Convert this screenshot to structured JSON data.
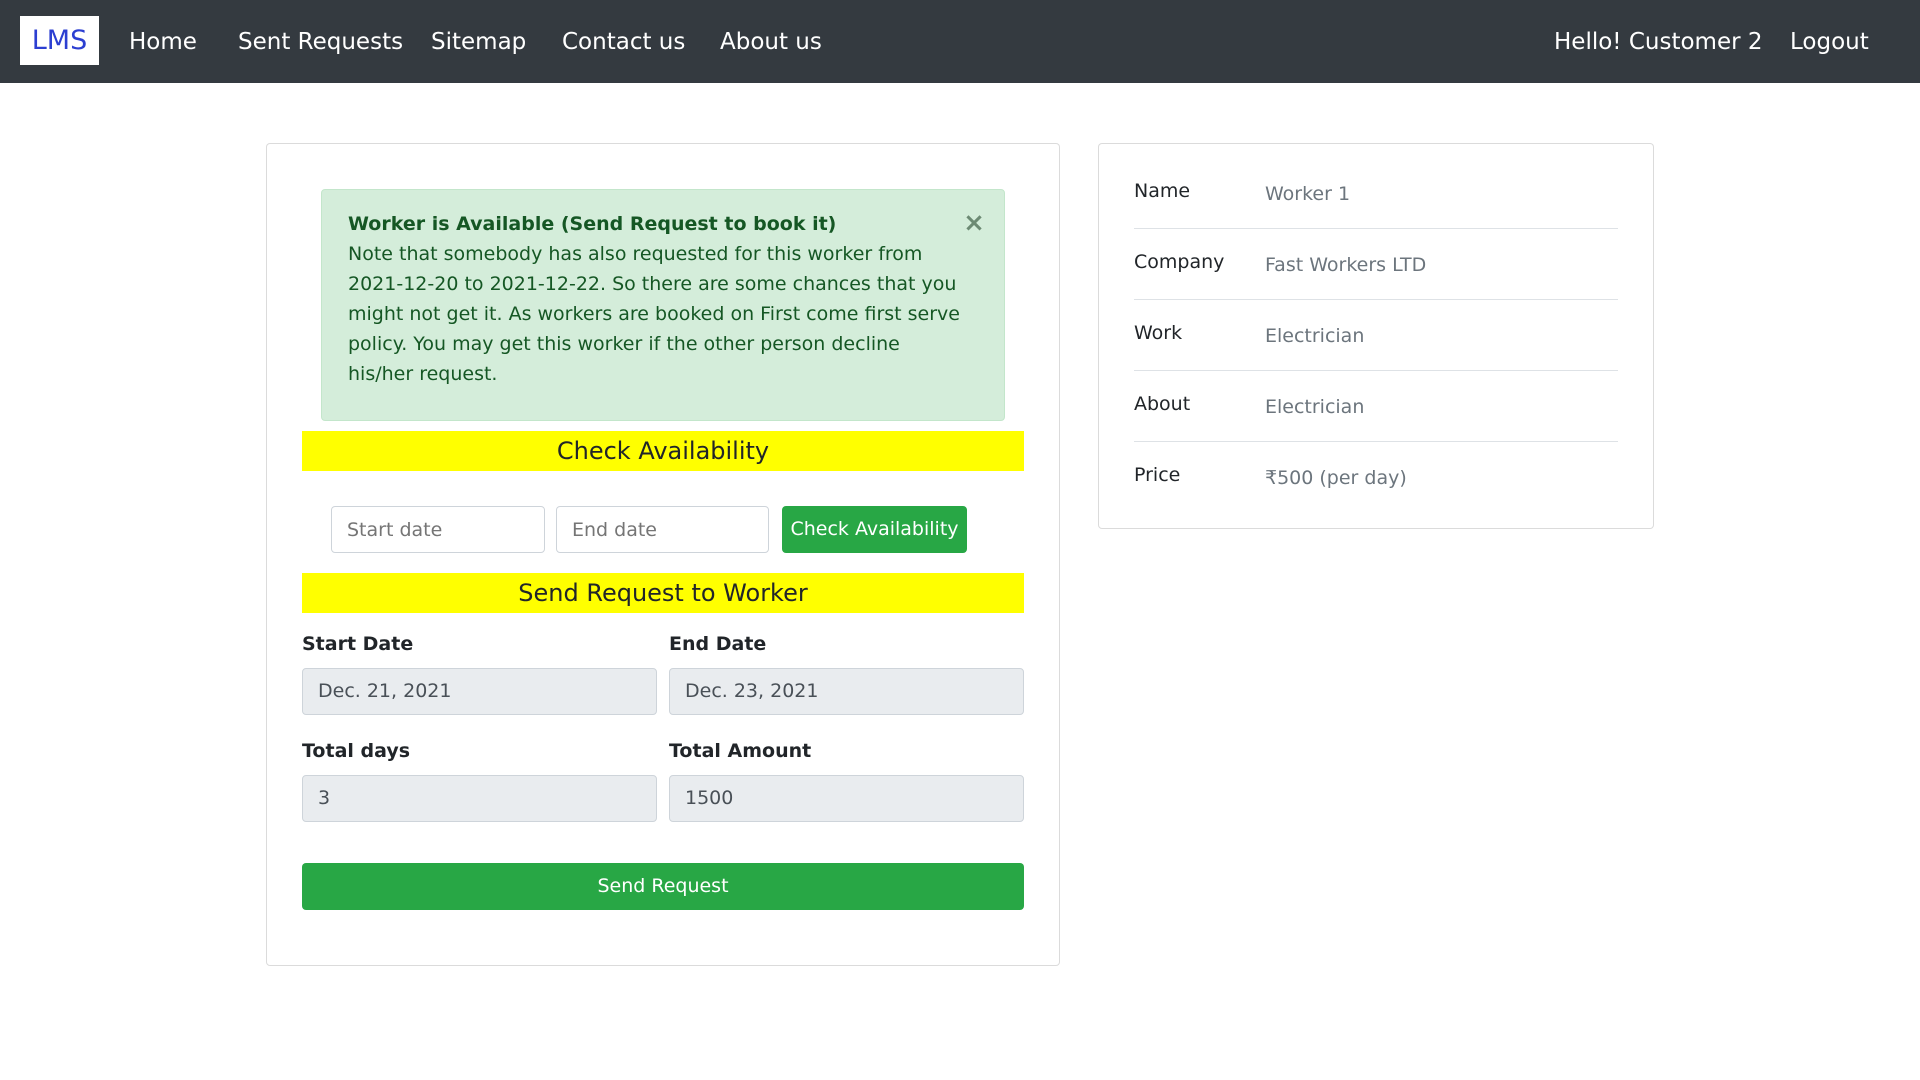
{
  "navbar": {
    "brand": "LMS",
    "links": [
      "Home",
      "Sent Requests",
      "Sitemap",
      "Contact us",
      "About us"
    ],
    "greeting": "Hello! Customer 2",
    "logout": "Logout"
  },
  "alert": {
    "title": "Worker is Available (Send Request to book it)",
    "lines": [
      "Note that somebody has also requested for this worker from",
      "2021-12-20 to 2021-12-22. So there are some chances that you",
      "might not get it. As workers are booked on First come first serve",
      "policy. You may get this worker if the other person decline",
      "his/her request."
    ],
    "close": "×"
  },
  "check_availability": {
    "heading": "Check Availability",
    "start_placeholder": "Start date",
    "end_placeholder": "End date",
    "button": "Check Availability"
  },
  "send_request": {
    "heading": "Send Request to Worker",
    "start_date_label": "Start Date",
    "start_date_value": "Dec. 21, 2021",
    "end_date_label": "End Date",
    "end_date_value": "Dec. 23, 2021",
    "total_days_label": "Total days",
    "total_days_value": "3",
    "total_amount_label": "Total Amount",
    "total_amount_value": "1500",
    "button": "Send Request"
  },
  "worker_info": [
    {
      "key": "Name",
      "value": "Worker 1"
    },
    {
      "key": "Company",
      "value": "Fast Workers LTD"
    },
    {
      "key": "Work",
      "value": "Electrician"
    },
    {
      "key": "About",
      "value": "Electrician"
    },
    {
      "key": "Price",
      "value": "₹500 (per day)"
    }
  ],
  "colors": {
    "navbar": "#343a40",
    "brand_text": "#2c3fd1",
    "success": "#28a745",
    "alert_bg": "#d4edda",
    "alert_text": "#155724",
    "section_bar": "#ffff00"
  }
}
